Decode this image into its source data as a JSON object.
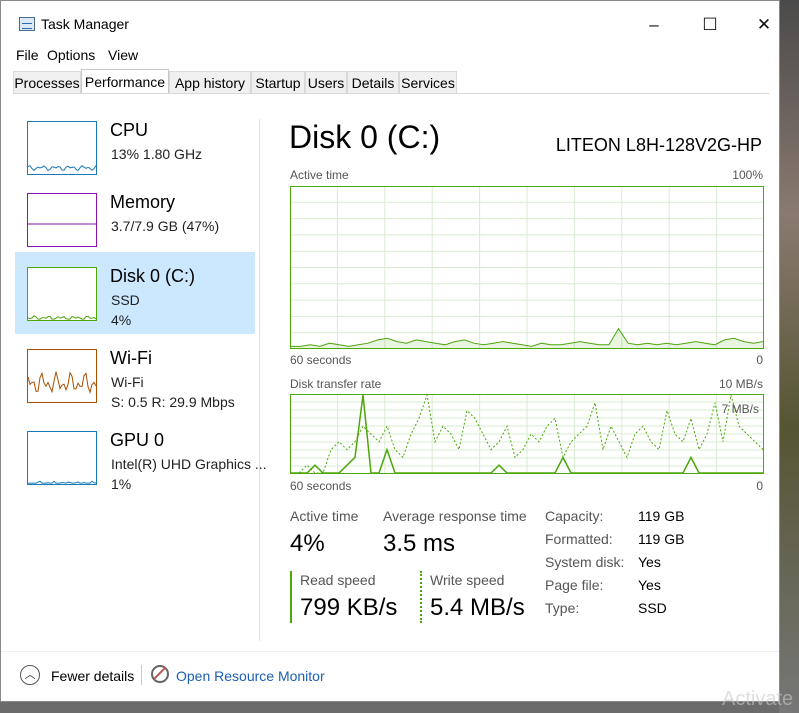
{
  "window": {
    "title": "Task Manager",
    "controls": {
      "minimize": "–",
      "maximize": "☐",
      "close": "✕"
    }
  },
  "menu": [
    "File",
    "Options",
    "View"
  ],
  "tabs": [
    "Processes",
    "Performance",
    "App history",
    "Startup",
    "Users",
    "Details",
    "Services"
  ],
  "active_tab": "Performance",
  "sidebar": {
    "items": [
      {
        "name": "CPU",
        "line1": "13%  1.80 GHz",
        "line2": "",
        "color": "#1779ba",
        "level": 0.13
      },
      {
        "name": "Memory",
        "line1": "3.7/7.9 GB (47%)",
        "line2": "",
        "color": "#8b12ae",
        "level": 0.47
      },
      {
        "name": "Disk 0 (C:)",
        "line1": "SSD",
        "line2": "4%",
        "color": "#4da60c",
        "level": 0.04
      },
      {
        "name": "Wi-Fi",
        "line1": "Wi-Fi",
        "line2": "S: 0.5  R: 29.9 Mbps",
        "color": "#a74f01",
        "level": 0.4
      },
      {
        "name": "GPU 0",
        "line1": "Intel(R) UHD Graphics ...",
        "line2": "1%",
        "color": "#1779ba",
        "level": 0.01
      }
    ],
    "selected": "Disk 0 (C:)"
  },
  "disk": {
    "title": "Disk 0 (C:)",
    "model": "LITEON L8H-128V2G-HP",
    "active_graph": {
      "label": "Active time",
      "max_label": "100%",
      "time_label": "60 seconds",
      "min_label": "0",
      "color": "#4da60c",
      "values": [
        1,
        1,
        2,
        1,
        3,
        2,
        1,
        2,
        3,
        5,
        6,
        4,
        3,
        5,
        4,
        3,
        2,
        4,
        5,
        3,
        2,
        3,
        4,
        3,
        2,
        1,
        3,
        2,
        2,
        3,
        4,
        3,
        2,
        2,
        12,
        3,
        2,
        3,
        2,
        3,
        2,
        3,
        4,
        3,
        2,
        5,
        6,
        4,
        3,
        4
      ]
    },
    "transfer_graph": {
      "label": "Disk transfer rate",
      "max_label": "10 MB/s",
      "secondary_label": "7 MB/s",
      "time_label": "60 seconds",
      "min_label": "0",
      "color": "#4da60c",
      "read_values": [
        0,
        0,
        0,
        1,
        0,
        0,
        0,
        1,
        2,
        18,
        0,
        0,
        3,
        0,
        0,
        0,
        0,
        0,
        0,
        0,
        0,
        0,
        0,
        0,
        0,
        0,
        1,
        0,
        0,
        0,
        0,
        0,
        0,
        0,
        2,
        0,
        0,
        0,
        0,
        0,
        0,
        0,
        0,
        0,
        0,
        0,
        0,
        0,
        0,
        0,
        2,
        0,
        0,
        0,
        0,
        0,
        0,
        0,
        0,
        0
      ],
      "write_values": [
        0,
        0,
        1,
        0,
        0,
        3,
        4,
        3,
        4,
        6,
        5,
        4,
        6,
        3,
        2,
        5,
        7,
        10,
        4,
        6,
        5,
        3,
        8,
        7,
        5,
        3,
        4,
        6,
        2,
        3,
        5,
        4,
        6,
        7,
        2,
        4,
        5,
        6,
        9,
        3,
        6,
        4,
        2,
        5,
        6,
        4,
        3,
        8,
        5,
        4,
        7,
        3,
        5,
        9,
        4,
        10,
        6,
        5,
        4,
        3
      ]
    },
    "stats": {
      "active_time": {
        "label": "Active time",
        "value": "4%"
      },
      "avg_response": {
        "label": "Average response time",
        "value": "3.5 ms"
      },
      "read_speed": {
        "label": "Read speed",
        "value": "799 KB/s"
      },
      "write_speed": {
        "label": "Write speed",
        "value": "5.4 MB/s"
      }
    },
    "info": [
      {
        "label": "Capacity:",
        "value": "119 GB"
      },
      {
        "label": "Formatted:",
        "value": "119 GB"
      },
      {
        "label": "System disk:",
        "value": "Yes"
      },
      {
        "label": "Page file:",
        "value": "Yes"
      },
      {
        "label": "Type:",
        "value": "SSD"
      }
    ]
  },
  "footer": {
    "fewer_details": "Fewer details",
    "resource_monitor": "Open Resource Monitor"
  },
  "watermark": "Activate"
}
